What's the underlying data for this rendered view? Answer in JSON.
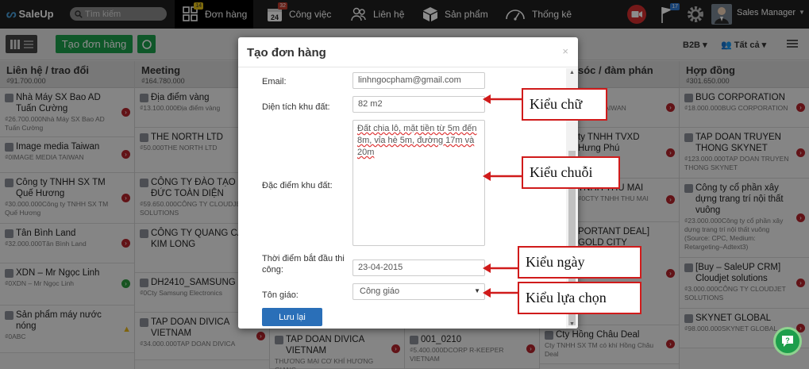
{
  "navbar": {
    "logo": "SaleUp",
    "search_placeholder": "Tìm kiếm",
    "items": [
      {
        "label": "Đơn hàng",
        "badge": "14",
        "icon": "grid-icon"
      },
      {
        "label": "Công việc",
        "badge": "32",
        "icon": "calendar-icon"
      },
      {
        "label": "Liên hệ",
        "badge": "",
        "icon": "contacts-icon"
      },
      {
        "label": "Sản phẩm",
        "badge": "",
        "icon": "box-icon"
      },
      {
        "label": "Thống kê",
        "badge": "",
        "icon": "gauge-icon"
      }
    ],
    "flag_badge": "17",
    "user_name": "Sales Manager"
  },
  "toolbar": {
    "create_label": "Tạo đơn hàng",
    "filter_b2b": "B2B",
    "filter_all": "Tất cả"
  },
  "columns": [
    {
      "title": "Liên hệ / trao đổi",
      "sum": "₫91.700.000",
      "cards": [
        {
          "title": "Nhà Máy SX Bao AD Tuấn Cường",
          "sub": "₫26.700.000Nhà Máy SX Bao AD Tuấn Cường",
          "status": "red"
        },
        {
          "title": "Image media Taiwan",
          "sub": "₫0IMAGE MEDIA TAIWAN",
          "status": "red"
        },
        {
          "title": "Công ty TNHH SX TM Quế Hương",
          "sub": "₫30.000.000Công ty TNHH SX TM Quế Hương",
          "status": "red"
        },
        {
          "title": "Tân Bình Land",
          "sub": "₫32.000.000Tân Bình Land",
          "status": "red"
        },
        {
          "title": "XDN – Mr Ngọc Linh",
          "sub": "₫0XDN – Mr Ngọc Linh",
          "status": "green"
        },
        {
          "title": "Sản phẩm máy nước nóng",
          "sub": "₫0ABC",
          "status": "warn"
        }
      ]
    },
    {
      "title": "Meeting",
      "sum": "₫164.780.000",
      "cards": [
        {
          "title": "Địa điểm vàng",
          "sub": "₫13.100.000Địa điểm vàng",
          "status": "red"
        },
        {
          "title": "THE NORTH LTD",
          "sub": "₫50.000THE NORTH LTD",
          "status": "red"
        },
        {
          "title": "CÔNG TY ĐÀO TẠO ĐỨC TOÀN DIỆN",
          "sub": "₫59.650.000CÔNG TY CLOUDJET SOLUTIONS",
          "status": "red"
        },
        {
          "title": "CÔNG TY QUANG CÁO KIM LONG",
          "sub": "",
          "status": "red"
        },
        {
          "title": "DH2410_SAMSUNG",
          "sub": "₫0Cty Samsung Electronics",
          "status": "red"
        },
        {
          "title": "TAP DOAN DIVICA VIETNAM",
          "sub": "₫34.000.000TAP DOAN DIVICA",
          "status": "red"
        }
      ]
    },
    {
      "title": "",
      "sum": "",
      "cards": [
        {
          "title": "TAP DOAN DIVICA VIETNAM",
          "sub": "THƯƠNG MẠI CƠ KHÍ HƯƠNG GIANG",
          "status": "red"
        }
      ]
    },
    {
      "title": "",
      "sum": "",
      "cards": [
        {
          "title": "001_0210",
          "sub": "₫5.400.000DCORP R-KEEPER VIETNAM",
          "status": "red"
        }
      ]
    },
    {
      "title": "sóc / đàm phán",
      "sum": "",
      "cards": [
        {
          "title": "UP_30",
          "sub": "MEDIA TAIWAN",
          "status": "red"
        },
        {
          "title": "ty TNHH TVXD Hưng Phú",
          "sub": "TVXD",
          "status": "red"
        },
        {
          "title": "TNHH THU MAI",
          "sub": "₫0CTY TNHH THU MAI",
          "status": "red"
        },
        {
          "title": "PORTANT DEAL] GOLD CITY",
          "sub": "",
          "status": "red"
        },
        {
          "title": "Cty Hồng Châu Deal",
          "sub": "Cty TNHH SX TM có khí Hồng Châu Deal",
          "status": "red"
        }
      ]
    },
    {
      "title": "Hợp đồng",
      "sum": "₫301.650.000",
      "cards": [
        {
          "title": "BUG CORPORATION",
          "sub": "₫18.000.000BUG CORPORATION",
          "status": "red"
        },
        {
          "title": "TAP DOAN TRUYEN THONG SKYNET",
          "sub": "₫123.000.000TAP DOAN TRUYEN THONG SKYNET",
          "status": "red"
        },
        {
          "title": "Công ty cổ phần xây dựng trang trí nội thất vuông",
          "sub": "₫23.000.000Công ty cổ phần xây dựng trang trí nội thất vuông (Source: CPC, Medium: Retargeting–Adtext3)",
          "status": "red"
        },
        {
          "title": "[Buy – SaleUP CRM] Cloudjet solutions",
          "sub": "₫3.000.000CÔNG TY CLOUDJET SOLUTIONS",
          "status": "red"
        },
        {
          "title": "SKYNET GLOBAL",
          "sub": "₫98.000.000SKYNET GLOBAL",
          "status": "red"
        }
      ]
    }
  ],
  "modal": {
    "title": "Tạo đơn hàng",
    "close": "×",
    "fields": {
      "email_label": "Email:",
      "email_value": "linhngocpham@gmail.com",
      "area_label": "Diện tích khu đất:",
      "area_value": "82 m2",
      "features_label": "Đặc điểm khu đất:",
      "features_value": "Đất chia lô, mặt tiền từ 5m đến 8m, vỉa hè 5m, đường 17m và 20m",
      "start_label": "Thời điểm bắt đầu thi công:",
      "start_value": "23-04-2015",
      "religion_label": "Tôn giáo:",
      "religion_value": "Công giáo"
    },
    "save_label": "Lưu lại"
  },
  "annotations": {
    "text_type": "Kiểu chữ",
    "string_type": "Kiểu chuỗi",
    "date_type": "Kiểu  ngày",
    "select_type": "Kiểu lựa chọn"
  },
  "colors": {
    "brand_green": "#1d9e4b",
    "save_blue": "#2a6fb8",
    "annotation_red": "#d01b1b",
    "navbar": "#1f1f1f"
  }
}
